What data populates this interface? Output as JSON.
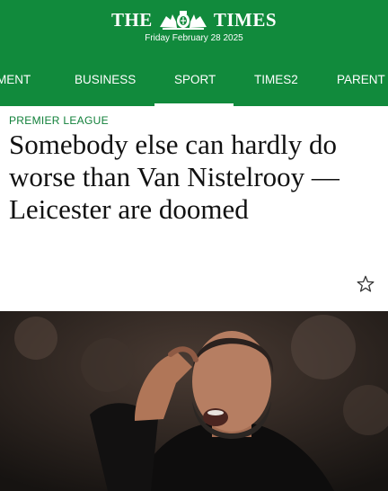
{
  "brand": {
    "name_left": "THE",
    "name_right": "TIMES",
    "date": "Friday February 28 2025"
  },
  "nav": {
    "items": [
      {
        "label": "MENT"
      },
      {
        "label": "BUSINESS"
      },
      {
        "label": "SPORT",
        "active": true
      },
      {
        "label": "TIMES2"
      },
      {
        "label": "PARENT"
      }
    ]
  },
  "article": {
    "kicker": "PREMIER LEAGUE",
    "headline": "Somebody else can hardly do worse than Van Nistelrooy — Leicester are doomed",
    "bookmark_icon": "star-outline-icon"
  },
  "colors": {
    "brand_green": "#118a3c",
    "kicker_green": "#11803a",
    "headline": "#111111"
  }
}
